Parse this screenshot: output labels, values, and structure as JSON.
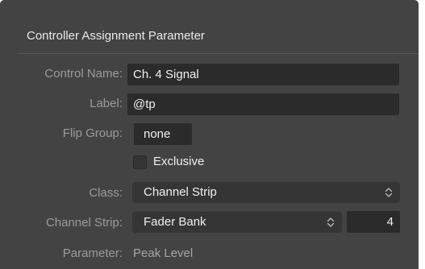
{
  "section": {
    "title": "Controller Assignment Parameter"
  },
  "control_name": {
    "label": "Control Name:",
    "value": "Ch. 4 Signal"
  },
  "label_field": {
    "label": "Label:",
    "value": "@tp"
  },
  "flip_group": {
    "label": "Flip Group:",
    "value": "none"
  },
  "exclusive": {
    "label": "Exclusive",
    "checked": false
  },
  "class_field": {
    "label": "Class:",
    "selected": "Channel Strip"
  },
  "channel_strip": {
    "label": "Channel Strip:",
    "selected": "Fader Bank",
    "number": "4"
  },
  "parameter": {
    "label": "Parameter:",
    "value": "Peak Level"
  },
  "icons": {
    "updown": "chevron-up-down-icon"
  },
  "colors": {
    "panel_background": "#434343",
    "field_background": "#2b2b2b",
    "popup_background": "#353535",
    "label_text": "#9b9b9b",
    "value_text": "#f0f0f0"
  }
}
